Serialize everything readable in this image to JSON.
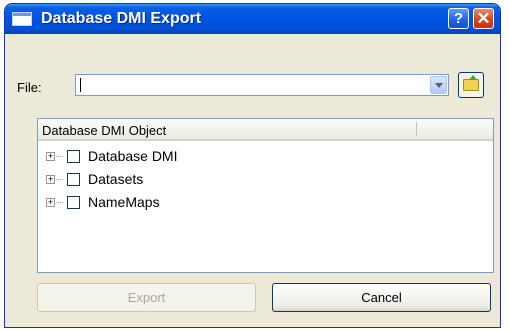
{
  "window": {
    "title": "Database DMI Export",
    "help_glyph": "?",
    "close_glyph": "✕",
    "colors": {
      "titlebar": "#0054e3",
      "dialog_bg": "#ece9d8"
    }
  },
  "file": {
    "label": "File:",
    "value": "",
    "browse_icon": "folder-open-icon"
  },
  "tree": {
    "column_header": "Database DMI Object",
    "items": [
      {
        "expander": "+",
        "label": "Database DMI",
        "checked": false
      },
      {
        "expander": "+",
        "label": "Datasets",
        "checked": false
      },
      {
        "expander": "+",
        "label": "NameMaps",
        "checked": false
      }
    ]
  },
  "buttons": {
    "export_label": "Export",
    "export_enabled": false,
    "cancel_label": "Cancel"
  }
}
